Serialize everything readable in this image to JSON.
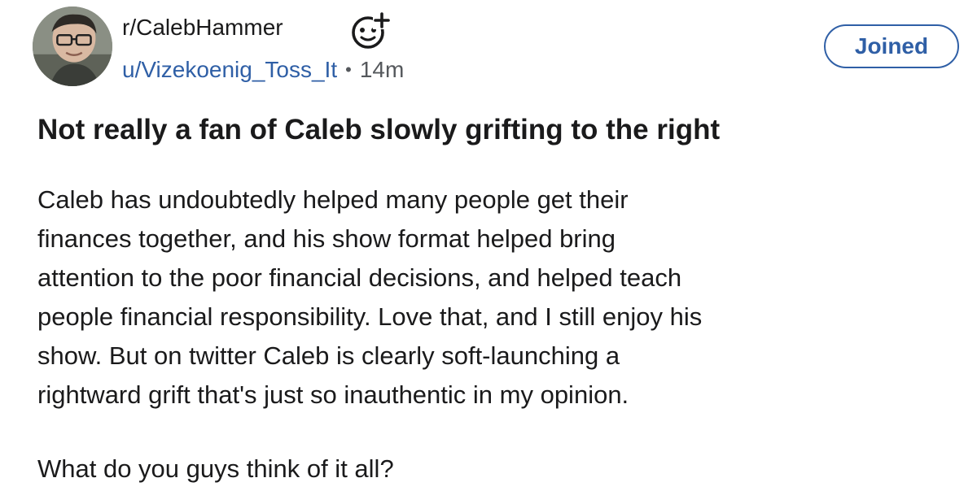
{
  "post": {
    "subreddit": "r/CalebHammer",
    "author": "u/Vizekoenig_Toss_It",
    "separator": "•",
    "age": "14m",
    "join_button_label": "Joined",
    "title": "Not really a fan of Caleb slowly grifting to the right",
    "body_lines": [
      "Caleb has undoubtedly helped many people get their",
      "finances together, and his show format helped bring",
      "attention to the poor financial decisions, and helped teach",
      "people financial responsibility. Love that, and I still enjoy his",
      "show. But on twitter Caleb is clearly soft-launching a",
      "rightward grift that's just so inauthentic in my opinion."
    ],
    "closing_question": "What do you guys think of it all?"
  },
  "icons": {
    "avatar": "user-avatar-photo",
    "add_snoo": "add-snoovatar-icon"
  },
  "colors": {
    "link_blue": "#2f5fa6",
    "text_primary": "#1a1a1b",
    "text_secondary": "#55585c",
    "background": "#ffffff"
  }
}
